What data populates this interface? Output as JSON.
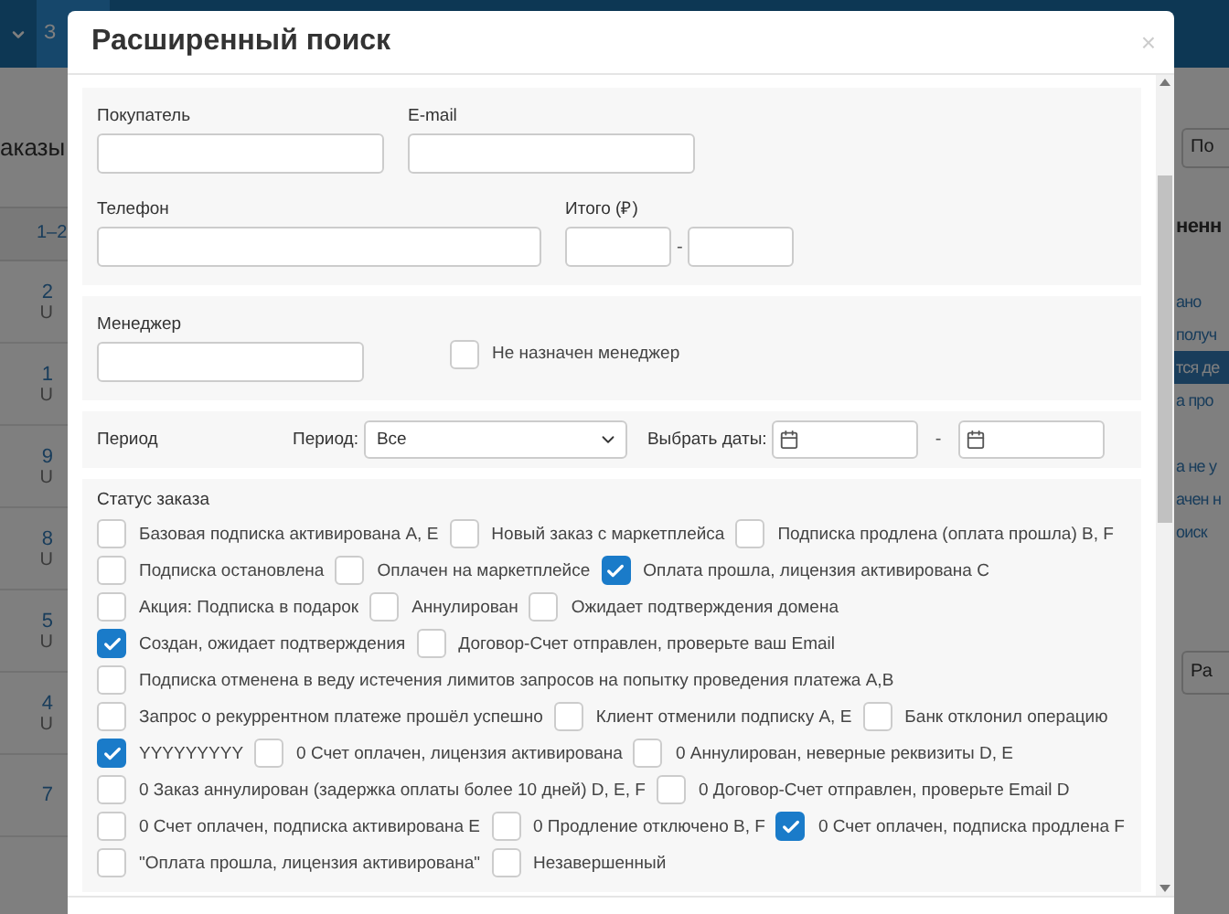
{
  "background": {
    "nav_tab": "З",
    "heading": "аказы",
    "pager": "1–2",
    "order_ids": [
      {
        "id": "2",
        "sub": "U"
      },
      {
        "id": "1",
        "sub": "U"
      },
      {
        "id": "9",
        "sub": "U"
      },
      {
        "id": "8",
        "sub": "U"
      },
      {
        "id": "5",
        "sub": "U"
      },
      {
        "id": "4",
        "sub": "U"
      },
      {
        "id": "7"
      }
    ],
    "right_button": "По",
    "right_heading": "ненн",
    "right_items": [
      {
        "label": "ано",
        "selected": false
      },
      {
        "label": "получ",
        "selected": false
      },
      {
        "label": "тся де",
        "selected": true
      },
      {
        "label": "а про",
        "selected": false
      }
    ],
    "right_items_2": [
      {
        "label": "а не у",
        "selected": false
      },
      {
        "label": "ачен н",
        "selected": false
      },
      {
        "label": "оиск",
        "selected": false
      }
    ],
    "right_button_2": "Ра"
  },
  "dialog": {
    "title": "Расширенный поиск",
    "close": "×",
    "contact": {
      "fields": [
        {
          "label": "Покупатель"
        },
        {
          "label": "E-mail"
        }
      ],
      "phone": {
        "label": "Телефон"
      },
      "total": {
        "label": "Итого (₽)",
        "separator": "-"
      }
    },
    "manager": {
      "label": "Менеджер",
      "unassigned": {
        "label": "Не назначен менеджер",
        "checked": false
      }
    },
    "period": {
      "label": "Период",
      "select_label": "Период:",
      "select_value": "Все",
      "dates_label": "Выбрать даты:",
      "separator": "-"
    },
    "statuses": {
      "title": "Статус заказа",
      "rows": [
        [
          {
            "label": "Базовая подписка активирована A, E",
            "checked": false
          },
          {
            "label": "Новый заказ с маркетплейса",
            "checked": false
          },
          {
            "label": "Подписка продлена (оплата прошла) B, F",
            "checked": false
          }
        ],
        [
          {
            "label": "Подписка остановлена",
            "checked": false
          },
          {
            "label": "Оплачен на маркетплейсе",
            "checked": false
          },
          {
            "label": "Оплата прошла, лицензия активирована C",
            "checked": true
          }
        ],
        [
          {
            "label": "Акция: Подписка в подарок",
            "checked": false
          },
          {
            "label": "Аннулирован",
            "checked": false
          },
          {
            "label": "Ожидает подтверждения домена",
            "checked": false
          }
        ],
        [
          {
            "label": "Создан, ожидает подтверждения",
            "checked": true
          },
          {
            "label": "Договор-Счет отправлен, проверьте ваш Email",
            "checked": false
          }
        ],
        [
          {
            "label": "Подписка отменена в веду истечения лимитов запросов на попытку проведения платежа A,B",
            "checked": false
          }
        ],
        [
          {
            "label": "Запрос о рекуррентном платеже прошёл успешно",
            "checked": false
          },
          {
            "label": "Клиент отменили подписку A, E",
            "checked": false
          },
          {
            "label": "Банк отклонил операцию",
            "checked": false
          }
        ],
        [
          {
            "label": "YYYYYYYYY",
            "checked": true
          },
          {
            "label": "0 Счет оплачен, лицензия активирована",
            "checked": false
          },
          {
            "label": "0 Аннулирован, неверные реквизиты D, E",
            "checked": false
          }
        ],
        [
          {
            "label": "0 Заказ аннулирован (задержка оплаты более 10 дней) D, E, F",
            "checked": false
          },
          {
            "label": "0 Договор-Счет отправлен, проверьте Email D",
            "checked": false
          }
        ],
        [
          {
            "label": "0 Счет оплачен, подписка активирована E",
            "checked": false
          },
          {
            "label": "0 Продление отключено B, F",
            "checked": false
          },
          {
            "label": "0 Счет оплачен, подписка продлена F",
            "checked": true
          }
        ],
        [
          {
            "label": "\"Оплата прошла, лицензия активирована\"",
            "checked": false
          },
          {
            "label": "Незавершенный",
            "checked": false
          }
        ]
      ]
    }
  }
}
